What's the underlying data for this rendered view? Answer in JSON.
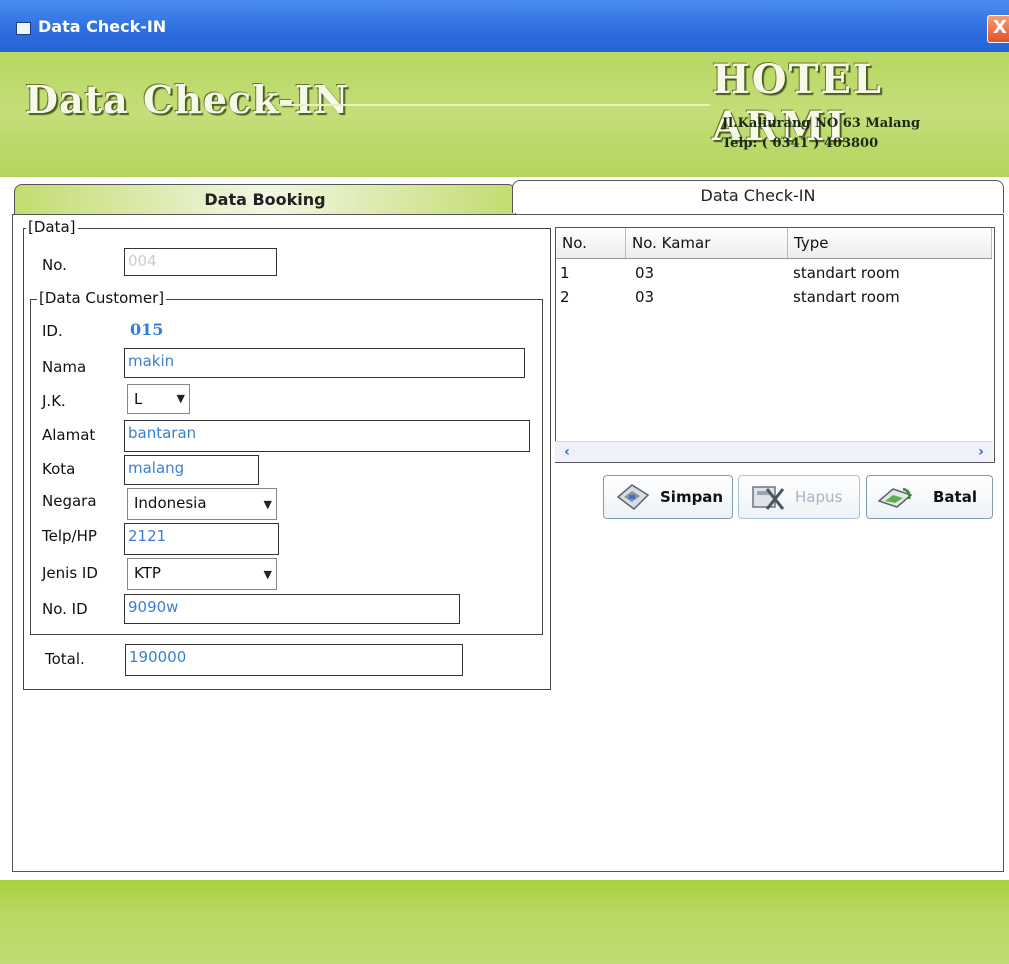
{
  "window": {
    "title": "Data Check-IN",
    "close_glyph": "X"
  },
  "header": {
    "title": "Data Check-IN",
    "hotel_name": "HOTEL ARMI",
    "address": "Jl.Kaliurang NO 63 Malang",
    "telp": "Telp: ( 0341 ) 403800"
  },
  "tabs": [
    {
      "label": "Data Booking",
      "active": true
    },
    {
      "label": "Data Check-IN",
      "active": false
    }
  ],
  "data_group": {
    "legend": "[Data]",
    "no_label": "No.",
    "no_value": "004"
  },
  "customer_group": {
    "legend": "[Data Customer]",
    "id_label": "ID.",
    "id_value": "015",
    "nama_label": "Nama",
    "nama_value": "makin",
    "jk_label": "J.K.",
    "jk_value": "L",
    "alamat_label": "Alamat",
    "alamat_value": "bantaran",
    "kota_label": "Kota",
    "kota_value": "malang",
    "negara_label": "Negara",
    "negara_value": "Indonesia",
    "telp_label": "Telp/HP",
    "telp_value": "2121",
    "jenis_label": "Jenis ID",
    "jenis_value": "KTP",
    "noid_label": "No. ID",
    "noid_value": "9090w"
  },
  "total": {
    "label": "Total.",
    "value": "190000"
  },
  "list": {
    "columns": [
      "No.",
      "No. Kamar",
      "Type"
    ],
    "rows": [
      [
        "1",
        "03",
        "standart room"
      ],
      [
        "2",
        "03",
        "standart room"
      ]
    ]
  },
  "buttons": {
    "simpan": "Simpan",
    "hapus": "Hapus",
    "batal": "Batal"
  },
  "icons": {
    "window": "window-app-icon",
    "simpan": "save-disk-icon",
    "hapus": "delete-icon",
    "batal": "cancel-icon"
  },
  "colors": {
    "header_green": "#b6d862",
    "titlebar_blue": "#2f6fe0",
    "input_text": "#3a7fd0"
  }
}
